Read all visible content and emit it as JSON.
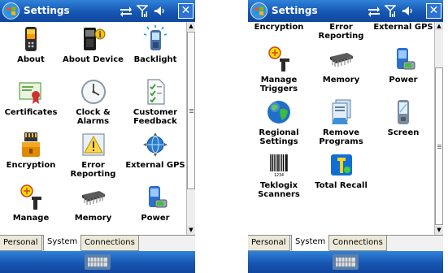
{
  "title": "Settings",
  "close_label": "✕",
  "tabs": [
    "Personal",
    "System",
    "Connections"
  ],
  "active_tab": "System",
  "items": {
    "about": "About",
    "about_device": "About Device",
    "backlight": "Backlight",
    "certificates": "Certificates",
    "clock_alarms": "Clock & Alarms",
    "customer_feedback": "Customer Feedback",
    "encryption": "Encryption",
    "error_reporting": "Error Reporting",
    "external_gps": "External GPS",
    "manage_triggers": "Manage Triggers",
    "memory": "Memory",
    "power": "Power",
    "regional_settings": "Regional Settings",
    "remove_programs": "Remove Programs",
    "screen": "Screen",
    "teklogix_scanners": "Teklogix Scanners",
    "total_recall": "Total Recall"
  },
  "cut_off": {
    "manage": "Manage",
    "memory": "Memory",
    "power": "Power"
  },
  "icons": [
    "windows-start-icon",
    "connectivity-icon",
    "signal-icon",
    "volume-icon",
    "keyboard-icon"
  ],
  "scroll": {
    "left_position": 0.0,
    "right_position": 1.0
  }
}
